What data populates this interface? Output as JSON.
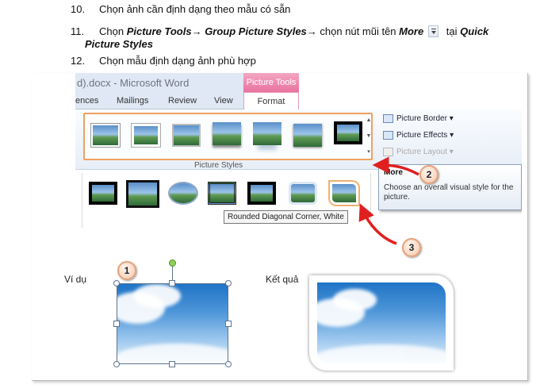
{
  "steps": [
    {
      "num": "10.",
      "text": "Chọn ảnh cần định dạng theo mẫu có sẵn"
    },
    {
      "num": "11.",
      "pre": "Chọn ",
      "b1": "Picture Tools",
      "arrow1": "→",
      "b2": " Group Picture Styles",
      "arrow2": "→",
      "mid": " chọn nút mũi tên ",
      "b3": "More",
      "post": " tại ",
      "b4": "Quick",
      "b5": "Picture Styles"
    },
    {
      "num": "12.",
      "text": "Chọn mẫu định dạng ảnh phù hợp"
    }
  ],
  "word": {
    "title": "d).docx - Microsoft Word",
    "context_tab": "Picture Tools",
    "tabs": [
      "ences",
      "Mailings",
      "Review",
      "View"
    ],
    "active_tab": "Format",
    "group_label": "Picture Styles",
    "commands": [
      "Picture Border ▾",
      "Picture Effects ▾",
      "Picture Layout ▾"
    ],
    "tooltip_title": "More",
    "tooltip_desc": "Choose an overall visual style for the picture.",
    "style_tip": "Rounded Diagonal Corner, White"
  },
  "callouts": [
    "1",
    "2",
    "3"
  ],
  "example_label": "Ví dụ",
  "result_label": "Kết quả",
  "colors": {
    "accent_orange": "#f0a060",
    "arrow_red": "#e02020",
    "ribbon_blue": "#dfe8f4",
    "context_pink": "#e9729e"
  }
}
